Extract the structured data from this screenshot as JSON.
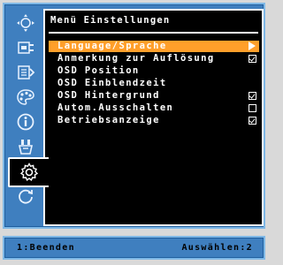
{
  "window": {
    "title": "Menü Einstellungen"
  },
  "sidebar": {
    "items": [
      {
        "icon": "move-icon",
        "active": false
      },
      {
        "icon": "input-source-icon",
        "active": false
      },
      {
        "icon": "display-adjust-icon",
        "active": false
      },
      {
        "icon": "color-palette-icon",
        "active": false
      },
      {
        "icon": "info-icon",
        "active": false
      },
      {
        "icon": "tools-icon",
        "active": false
      },
      {
        "icon": "gear-icon",
        "active": true
      },
      {
        "icon": "reset-icon",
        "active": false
      }
    ]
  },
  "menu": {
    "items": [
      {
        "label": "Language/Sprache",
        "control": "submenu-arrow",
        "selected": true
      },
      {
        "label": "Anmerkung zur Auflösung",
        "control": "checkbox",
        "checked": true
      },
      {
        "label": "OSD Position",
        "control": "none"
      },
      {
        "label": "OSD Einblendzeit",
        "control": "none"
      },
      {
        "label": "OSD Hintergrund",
        "control": "checkbox",
        "checked": true
      },
      {
        "label": "Autom.Ausschalten",
        "control": "checkbox",
        "checked": false
      },
      {
        "label": "Betriebsanzeige",
        "control": "checkbox",
        "checked": true
      }
    ]
  },
  "status": {
    "left": "1:Beenden",
    "right": "Auswählen:2"
  },
  "colors": {
    "frame_blue": "#3f7fbf",
    "frame_border": "#7fb8e6",
    "selection": "#ff9f2a",
    "panel": "#000000",
    "text": "#ffffff"
  }
}
